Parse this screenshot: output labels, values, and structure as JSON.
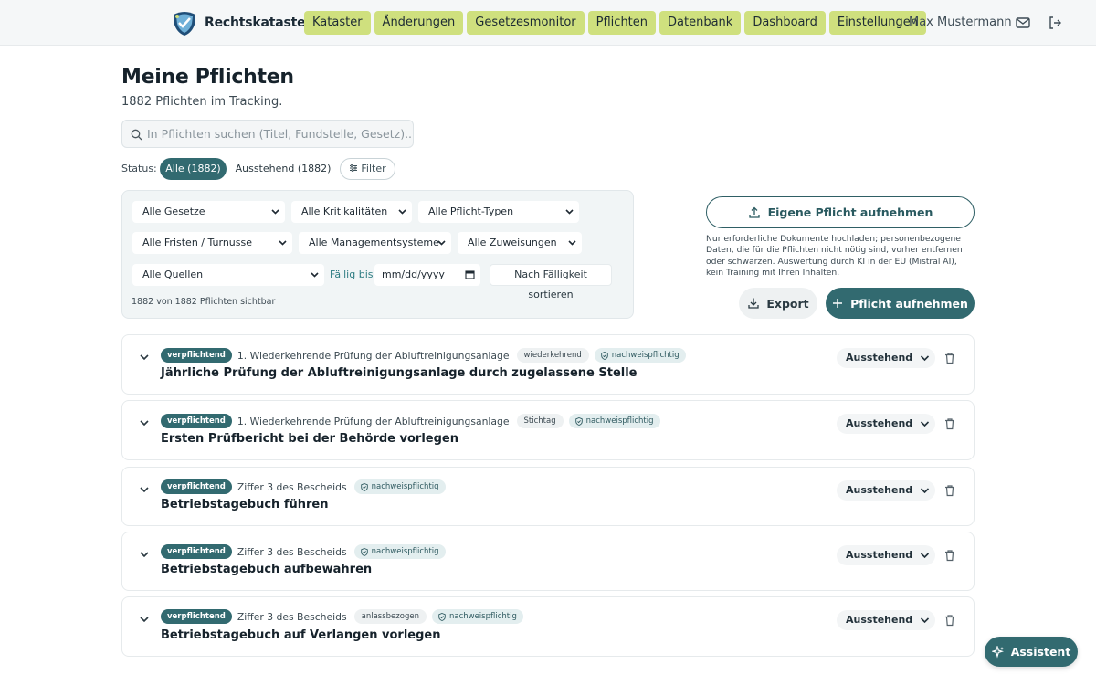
{
  "app": {
    "name": "Rechtskataster"
  },
  "nav": [
    {
      "label": "Kataster"
    },
    {
      "label": "Änderungen"
    },
    {
      "label": "Gesetzesmonitor"
    },
    {
      "label": "Pflichten"
    },
    {
      "label": "Datenbank"
    },
    {
      "label": "Dashboard"
    },
    {
      "label": "Einstellungen"
    }
  ],
  "user": {
    "name": "Max Mustermann",
    "mail_icon": "mail-icon",
    "logout_icon": "logout-icon"
  },
  "page": {
    "title": "Meine Pflichten",
    "subtitle": "1882 Pflichten im Tracking."
  },
  "search": {
    "placeholder": "In Pflichten suchen (Titel, Fundstelle, Gesetz)..."
  },
  "status": {
    "label": "Status:",
    "all": "Alle (1882)",
    "pending": "Ausstehend (1882)",
    "filter": "Filter"
  },
  "filters": {
    "gesetze": "Alle Gesetze",
    "kritikalitaeten": "Alle Kritikalitäten",
    "typen": "Alle Pflicht-Typen",
    "fristen": "Alle Fristen / Turnusse",
    "management": "Alle Managementsysteme",
    "zuweisungen": "Alle Zuweisungen",
    "quellen": "Alle Quellen",
    "faellig_label": "Fällig bis",
    "date_placeholder": "mm/dd/yyyy",
    "sort": "Nach Fälligkeit sortieren",
    "visible_count": "1882 von 1882 Pflichten sichtbar"
  },
  "actions": {
    "eigene": "Eigene Pflicht aufnehmen",
    "note": "Nur erforderliche Dokumente hochladen; personenbezogene Daten, die für die Pflichten nicht nötig sind, vorher entfernen oder schwärzen. Auswertung durch KI in der EU (Mistral AI), kein Training mit Ihren Inhalten.",
    "export": "Export",
    "add": "Pflicht aufnehmen"
  },
  "obligations": [
    {
      "badge": "verpflichtend",
      "source": "1. Wiederkehrende Prüfung der Abluftreinigungsanlage",
      "tags": [
        "wiederkehrend"
      ],
      "evidence": "nachweispflichtig",
      "title": "Jährliche Prüfung der Abluftreinigungsanlage durch zugelassene Stelle",
      "status": "Ausstehend"
    },
    {
      "badge": "verpflichtend",
      "source": "1. Wiederkehrende Prüfung der Abluftreinigungsanlage",
      "tags": [
        "Stichtag"
      ],
      "evidence": "nachweispflichtig",
      "title": "Ersten Prüfbericht bei der Behörde vorlegen",
      "status": "Ausstehend"
    },
    {
      "badge": "verpflichtend",
      "source": "Ziffer 3 des Bescheids",
      "tags": [],
      "evidence": "nachweispflichtig",
      "title": "Betriebstagebuch führen",
      "status": "Ausstehend"
    },
    {
      "badge": "verpflichtend",
      "source": "Ziffer 3 des Bescheids",
      "tags": [],
      "evidence": "nachweispflichtig",
      "title": "Betriebstagebuch aufbewahren",
      "status": "Ausstehend"
    },
    {
      "badge": "verpflichtend",
      "source": "Ziffer 3 des Bescheids",
      "tags": [
        "anlassbezogen"
      ],
      "evidence": "nachweispflichtig",
      "title": "Betriebstagebuch auf Verlangen vorlegen",
      "status": "Ausstehend"
    }
  ],
  "assistant": {
    "label": "Assistent"
  },
  "colors": {
    "accent": "#326a70",
    "nav": "#cfe07e",
    "link": "#2d7c82"
  }
}
